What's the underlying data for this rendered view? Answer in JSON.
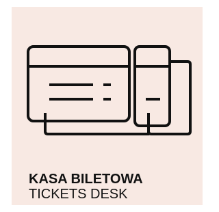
{
  "sign": {
    "background_color": "#f8e9e3",
    "ink_color": "#111111",
    "icon": "tickets-icon",
    "title_primary": "KASA BILETOWA",
    "title_secondary": "TICKETS DESK"
  }
}
